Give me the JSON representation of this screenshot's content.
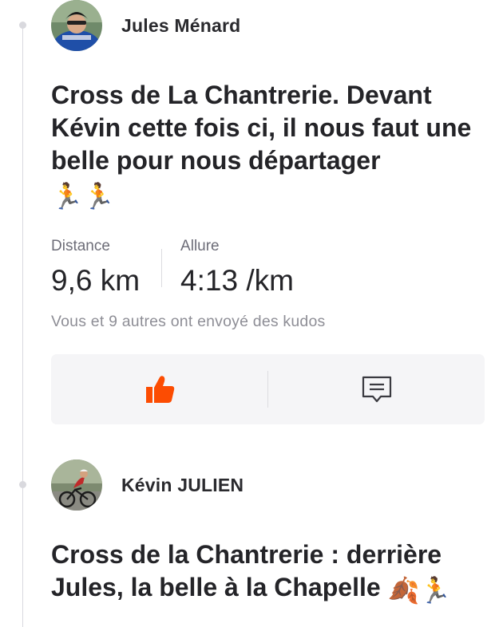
{
  "feed": {
    "posts": [
      {
        "athlete_name": "Jules Ménard",
        "avatar_icon": "cyclist-photo-avatar",
        "title": "Cross de La Chantrerie. Devant Kévin cette fois ci, il nous faut une belle pour nous départager",
        "title_emojis": "🏃🏃",
        "stats": [
          {
            "label": "Distance",
            "value": "9,6 km"
          },
          {
            "label": "Allure",
            "value": "4:13 /km"
          }
        ],
        "kudos_text": "Vous et 9 autres ont envoyé des kudos",
        "actions": {
          "kudos_icon": "thumbs-up-icon",
          "kudos_color": "#fc4c02",
          "comment_icon": "comment-icon"
        }
      },
      {
        "athlete_name": "Kévin JULIEN",
        "avatar_icon": "road-cyclist-photo-avatar",
        "title": "Cross de la Chantrerie : derrière Jules, la belle à la Chapelle",
        "title_emojis": "🍂🏃"
      }
    ]
  }
}
